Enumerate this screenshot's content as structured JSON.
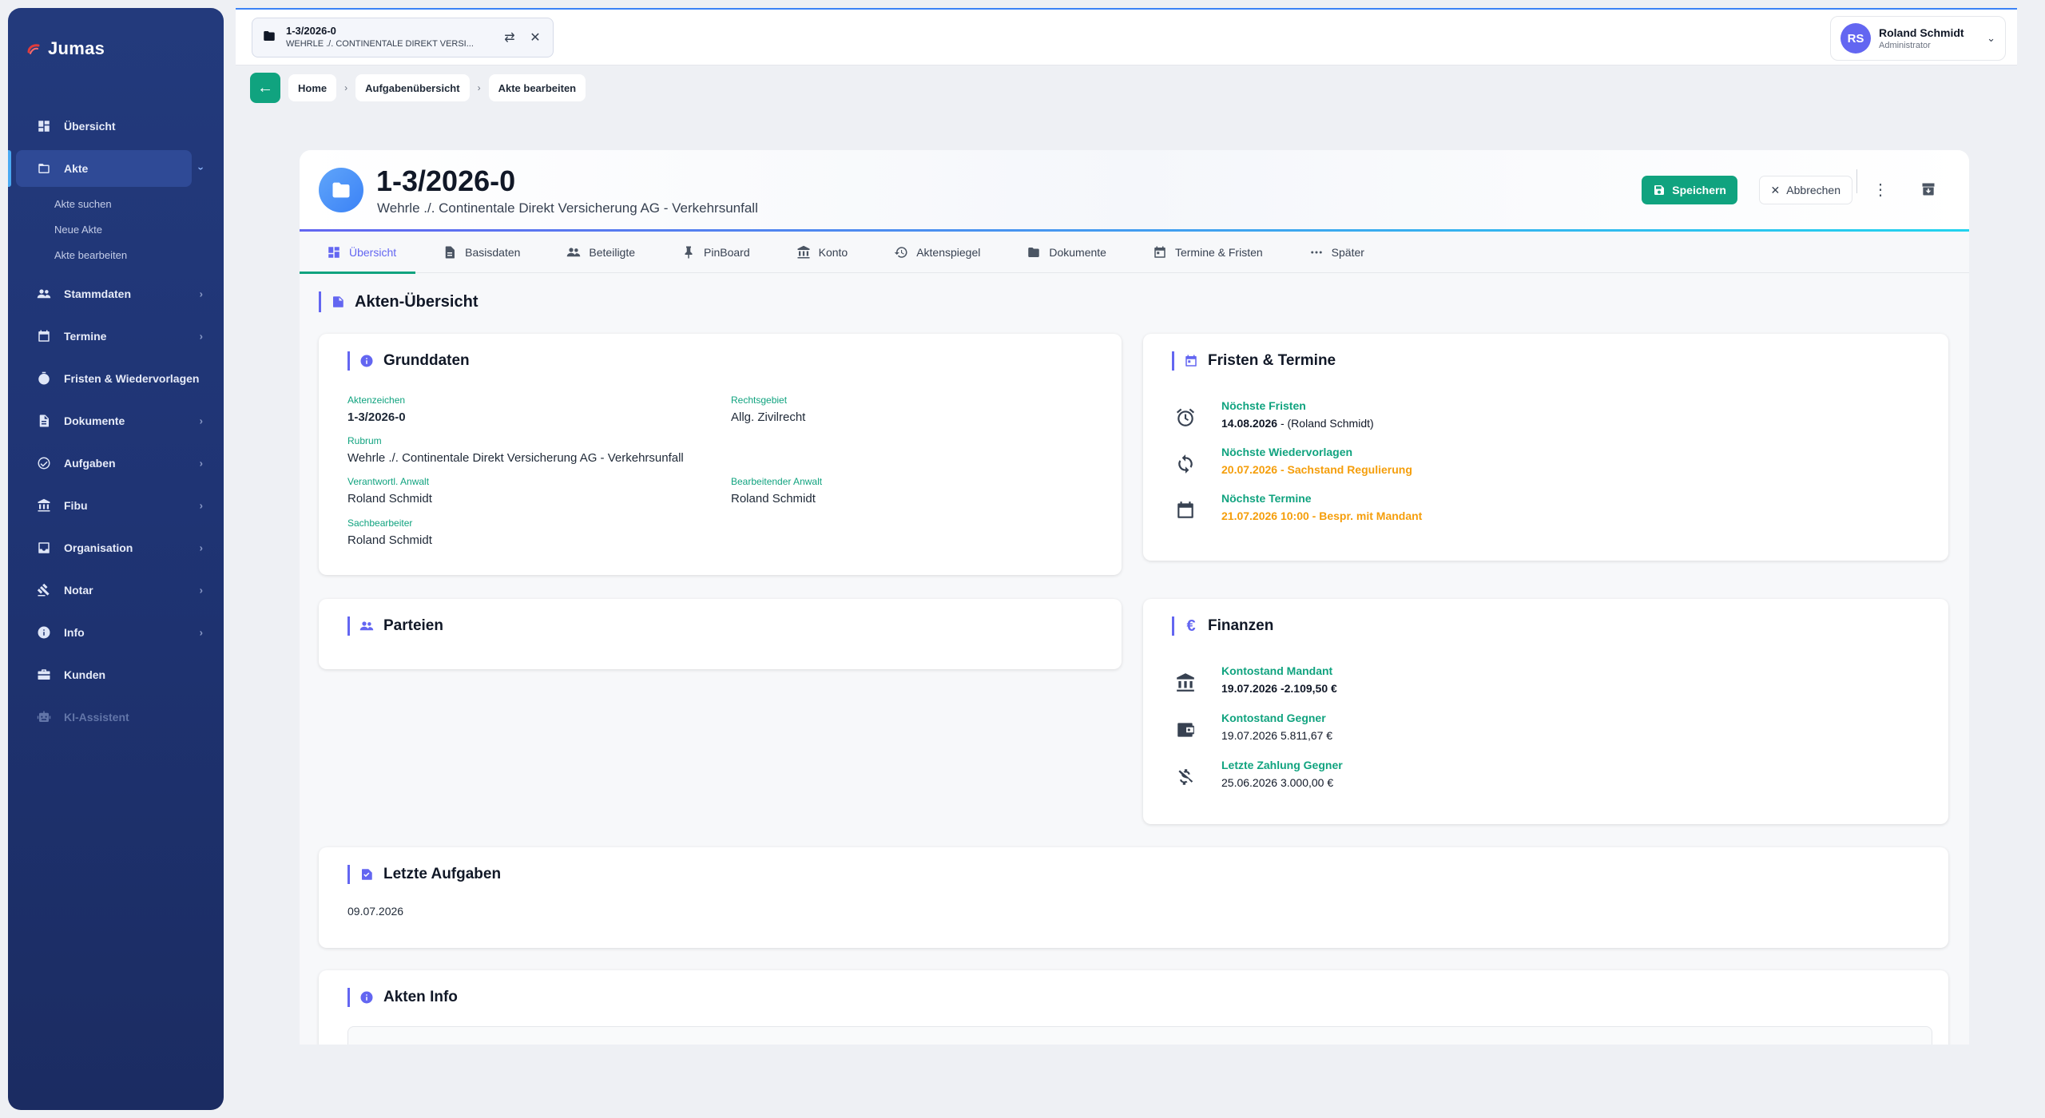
{
  "app": {
    "logo": "Jumas"
  },
  "sidebar": {
    "items": [
      {
        "label": "Übersicht",
        "icon": "dashboard-icon"
      },
      {
        "label": "Akte",
        "icon": "folder-icon"
      },
      {
        "label": "Stammdaten",
        "icon": "people-icon"
      },
      {
        "label": "Termine",
        "icon": "calendar-icon"
      },
      {
        "label": "Fristen & Wiedervorlagen",
        "icon": "timer-icon"
      },
      {
        "label": "Dokumente",
        "icon": "document-icon"
      },
      {
        "label": "Aufgaben",
        "icon": "task-icon"
      },
      {
        "label": "Fibu",
        "icon": "bank-icon"
      },
      {
        "label": "Organisation",
        "icon": "inbox-icon"
      },
      {
        "label": "Notar",
        "icon": "gavel-icon"
      },
      {
        "label": "Info",
        "icon": "info-icon"
      },
      {
        "label": "Kunden",
        "icon": "briefcase-icon"
      },
      {
        "label": "KI-Assistent",
        "icon": "robot-icon"
      }
    ],
    "akte_sub": [
      "Akte suchen",
      "Neue Akte",
      "Akte bearbeiten"
    ]
  },
  "topbar": {
    "tab_title": "1-3/2026-0",
    "tab_subtitle": "WEHRLE ./. CONTINENTALE DIREKT VERSI...",
    "user_initials": "RS",
    "user_name": "Roland Schmidt",
    "user_role": "Administrator"
  },
  "breadcrumb": [
    "Home",
    "Aufgabenübersicht",
    "Akte bearbeiten"
  ],
  "header": {
    "title": "1-3/2026-0",
    "subtitle": "Wehrle ./. Continentale Direkt Versicherung AG - Verkehrsunfall",
    "save_label": "Speichern",
    "cancel_label": "Abbrechen"
  },
  "tabs": [
    "Übersicht",
    "Basisdaten",
    "Beteiligte",
    "PinBoard",
    "Konto",
    "Aktenspiegel",
    "Dokumente",
    "Termine & Fristen",
    "Später"
  ],
  "section_title": "Akten-Übersicht",
  "grunddaten": {
    "title": "Grunddaten",
    "aktenzeichen_label": "Aktenzeichen",
    "aktenzeichen": "1-3/2026-0",
    "rechtsgebiet_label": "Rechtsgebiet",
    "rechtsgebiet": "Allg. Zivilrecht",
    "rubrum_label": "Rubrum",
    "rubrum": "Wehrle ./. Continentale Direkt Versicherung AG - Verkehrsunfall",
    "verantw_label": "Verantwortl. Anwalt",
    "verantw": "Roland Schmidt",
    "bearb_label": "Bearbeitender Anwalt",
    "bearb": "Roland Schmidt",
    "sachb_label": "Sachbearbeiter",
    "sachb": "Roland Schmidt"
  },
  "fristen": {
    "title": "Fristen & Termine",
    "frist_label": "Nöchste Fristen",
    "frist_date": "14.08.2026",
    "frist_rest": " - (Roland Schmidt)",
    "wv_label": "Nöchste Wiedervorlagen",
    "wv_value": "20.07.2026 - Sachstand Regulierung",
    "termin_label": "Nöchste Termine",
    "termin_value": "21.07.2026 10:00 - Bespr. mit Mandant"
  },
  "parteien": {
    "title": "Parteien"
  },
  "finanzen": {
    "title": "Finanzen",
    "mandant_label": "Kontostand Mandant",
    "mandant_value": "19.07.2026 -2.109,50 €",
    "gegner_label": "Kontostand Gegner",
    "gegner_value": "19.07.2026 5.811,67 €",
    "zahlung_label": "Letzte Zahlung Gegner",
    "zahlung_value": "25.06.2026 3.000,00 €"
  },
  "aufgaben": {
    "title": "Letzte Aufgaben",
    "date": "09.07.2026"
  },
  "akteninfo": {
    "title": "Akten Info"
  },
  "colors": {
    "sidebar": "#233a7c",
    "accent": "#10a37f",
    "primary": "#6366f1",
    "warning": "#f59e0b"
  }
}
